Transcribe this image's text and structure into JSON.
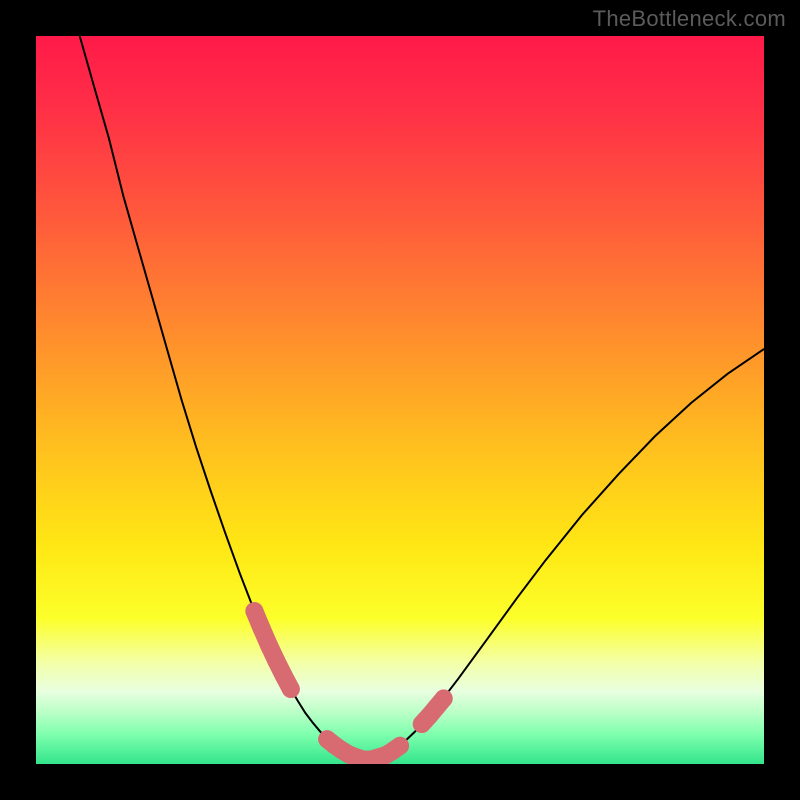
{
  "attribution": "TheBottleneck.com",
  "colors": {
    "bg": "#000000",
    "text": "#5b5b5b",
    "curve": "#000000",
    "marker": "#d76b71",
    "grad_stops": [
      {
        "o": 0.0,
        "c": "#ff1a49"
      },
      {
        "o": 0.1,
        "c": "#ff2f47"
      },
      {
        "o": 0.25,
        "c": "#ff5a3b"
      },
      {
        "o": 0.4,
        "c": "#ff8a2e"
      },
      {
        "o": 0.55,
        "c": "#ffbb20"
      },
      {
        "o": 0.7,
        "c": "#ffe714"
      },
      {
        "o": 0.8,
        "c": "#fcff2a"
      },
      {
        "o": 0.86,
        "c": "#f4ffa6"
      },
      {
        "o": 0.9,
        "c": "#e8ffe0"
      },
      {
        "o": 0.93,
        "c": "#b8ffc5"
      },
      {
        "o": 0.96,
        "c": "#7dffae"
      },
      {
        "o": 1.0,
        "c": "#33e58b"
      }
    ]
  },
  "chart_data": {
    "type": "line",
    "title": "",
    "xlabel": "",
    "ylabel": "",
    "xlim": [
      0,
      100
    ],
    "ylim": [
      0,
      100
    ],
    "series": [
      {
        "name": "curve",
        "x": [
          6,
          8,
          10,
          12,
          14,
          16,
          18,
          20,
          22,
          24,
          26,
          28,
          30,
          32,
          33,
          34,
          35,
          36,
          37,
          38,
          39,
          40,
          41,
          42,
          43,
          44,
          45,
          46,
          48,
          50,
          52,
          55,
          58,
          62,
          66,
          70,
          75,
          80,
          85,
          90,
          95,
          100
        ],
        "y": [
          100,
          93,
          86,
          78,
          71,
          64,
          57,
          50,
          43.5,
          37.5,
          31.7,
          26.2,
          21,
          16.3,
          14.2,
          12.2,
          10.3,
          8.6,
          7,
          5.7,
          4.5,
          3.4,
          2.6,
          1.9,
          1.3,
          0.9,
          0.6,
          0.6,
          1.2,
          2.5,
          4.4,
          7.8,
          11.7,
          17.2,
          22.7,
          28,
          34.2,
          39.8,
          45,
          49.6,
          53.6,
          57
        ]
      }
    ],
    "markers": [
      {
        "x": 30,
        "y": 21
      },
      {
        "x": 31,
        "y": 18.6
      },
      {
        "x": 32,
        "y": 16.3
      },
      {
        "x": 33,
        "y": 14.2
      },
      {
        "x": 34,
        "y": 12.2
      },
      {
        "x": 35,
        "y": 10.3
      },
      {
        "x": 40,
        "y": 3.4
      },
      {
        "x": 41,
        "y": 2.6
      },
      {
        "x": 42,
        "y": 1.9
      },
      {
        "x": 43,
        "y": 1.3
      },
      {
        "x": 44,
        "y": 0.9
      },
      {
        "x": 45,
        "y": 0.6
      },
      {
        "x": 46,
        "y": 0.6
      },
      {
        "x": 48,
        "y": 1.2
      },
      {
        "x": 49,
        "y": 1.8
      },
      {
        "x": 50,
        "y": 2.5
      },
      {
        "x": 53,
        "y": 5.5
      },
      {
        "x": 54,
        "y": 6.6
      },
      {
        "x": 55,
        "y": 7.8
      },
      {
        "x": 56,
        "y": 9.0
      }
    ]
  }
}
